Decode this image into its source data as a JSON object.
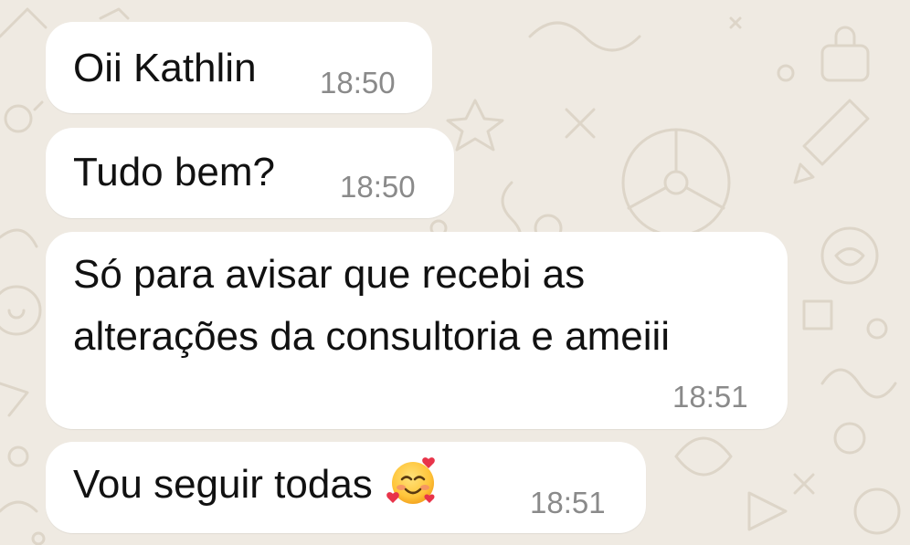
{
  "chat": {
    "background_color": "#EFEAE2",
    "bubble_color": "#FFFFFF",
    "messages": [
      {
        "lines": [
          "Oii Kathlin"
        ],
        "time": "18:50"
      },
      {
        "lines": [
          "Tudo bem?"
        ],
        "time": "18:50"
      },
      {
        "lines": [
          "Só para avisar que recebi as",
          "alterações da consultoria e ameiii"
        ],
        "time": "18:51"
      },
      {
        "lines": [
          "Vou seguir todas"
        ],
        "emoji": "smiling-face-with-hearts",
        "time": "18:51"
      }
    ]
  }
}
